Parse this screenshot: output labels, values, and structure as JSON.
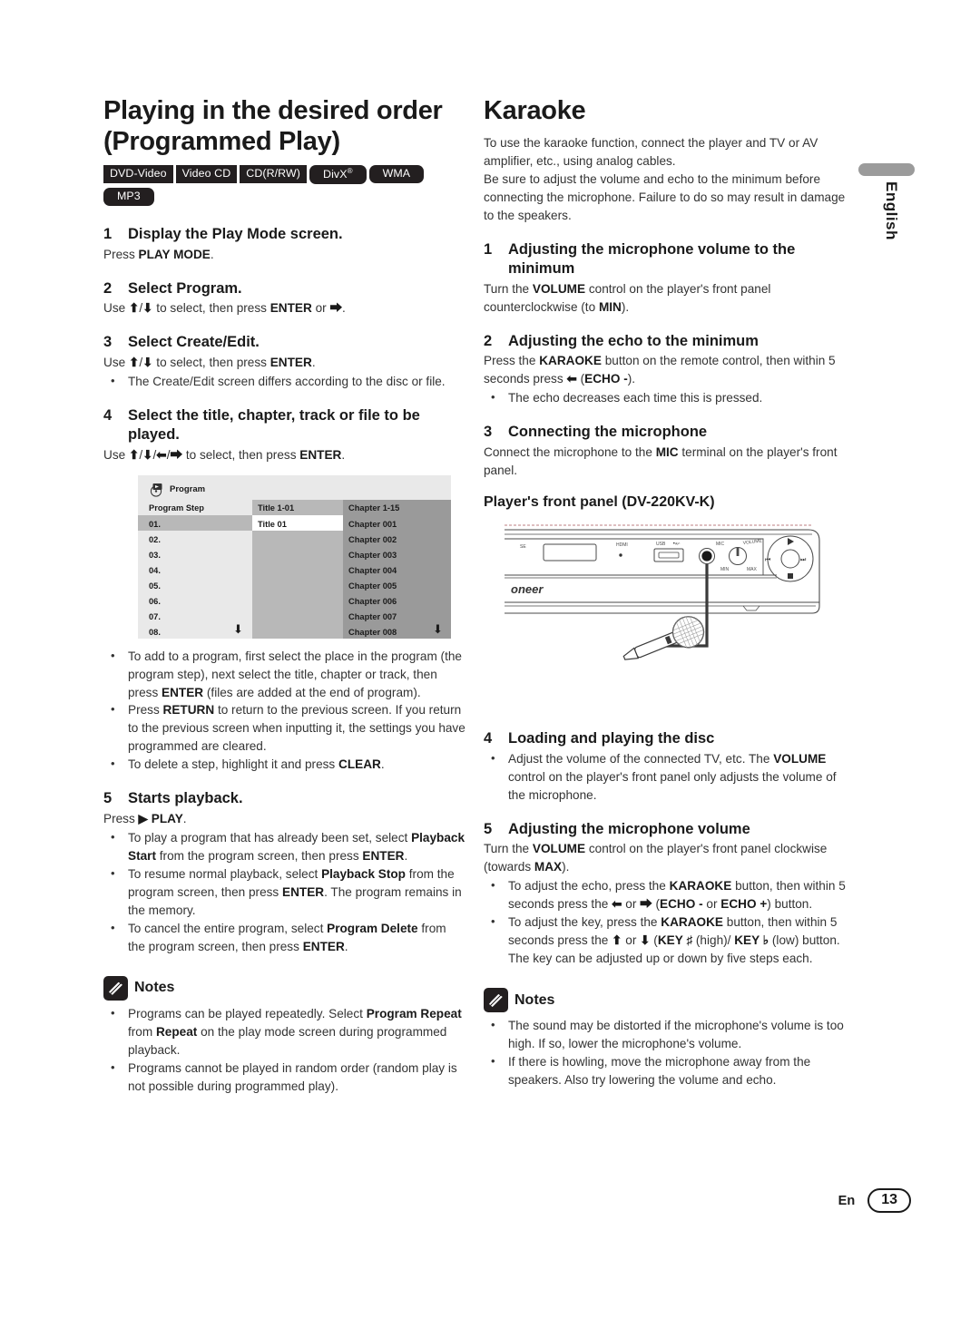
{
  "page": {
    "language_tab": "English",
    "footer_locale": "En",
    "page_number": "13"
  },
  "left_column": {
    "title": "Playing in the desired order (Programmed Play)",
    "badges": [
      {
        "label": "DVD-Video",
        "shape": "square"
      },
      {
        "label": "Video CD",
        "shape": "square"
      },
      {
        "label": "CD(R/RW)",
        "shape": "square"
      },
      {
        "label": "DivX®",
        "shape": "round"
      },
      {
        "label": "WMA",
        "shape": "round"
      },
      {
        "label": "MP3",
        "shape": "round"
      }
    ],
    "steps": [
      {
        "num": "1",
        "head": "Display the Play Mode screen.",
        "body_html": "Press <b>PLAY MODE</b>.",
        "bullets": []
      },
      {
        "num": "2",
        "head": "Select Program.",
        "body_html": "Use <b>⬆</b>/<b>⬇</b> to select, then press <b>ENTER</b> or <b>⮕</b>.",
        "bullets": []
      },
      {
        "num": "3",
        "head": "Select Create/Edit.",
        "body_html": "Use <b>⬆</b>/<b>⬇</b> to select, then press <b>ENTER</b>.",
        "bullets": [
          "The Create/Edit screen differs according to the disc or file."
        ]
      },
      {
        "num": "4",
        "head": "Select the title, chapter, track or file to be played.",
        "body_html": "Use <b>⬆</b>/<b>⬇</b>/<b>⬅</b>/<b>⮕</b> to select, then press <b>ENTER</b>.",
        "bullets": []
      }
    ],
    "osd": {
      "title": "Program",
      "header_step": "Program Step",
      "header_title": "Title  1-01",
      "header_chapter": "Chapter  1-15",
      "steps": [
        "01.",
        "02.",
        "03.",
        "04.",
        "05.",
        "06.",
        "07.",
        "08."
      ],
      "selected_title_cell": "Title  01",
      "chapters": [
        "Chapter  001",
        "Chapter  002",
        "Chapter  003",
        "Chapter  004",
        "Chapter  005",
        "Chapter  006",
        "Chapter  007",
        "Chapter  008"
      ],
      "scroll_arrow": "⬇"
    },
    "after_osd_bullets": [
      "To add to a program, first select the place in the program (the program step), next select the title, chapter or track, then press <b>ENTER</b> (files are added at the end of program).",
      "Press <b>RETURN</b> to return to the previous screen. If you return to the previous screen when inputting it, the settings you have programmed are cleared.",
      "To delete a step, highlight it and press <b>CLEAR</b>."
    ],
    "step5": {
      "num": "5",
      "head": "Starts playback.",
      "body_html": "Press <b>▶ PLAY</b>.",
      "bullets": [
        "To play a program that has already been set, select <b>Playback Start</b> from the program screen, then press <b>ENTER</b>.",
        "To resume normal playback, select <b>Playback Stop</b> from the program screen, then press <b>ENTER</b>. The program remains in the memory.",
        "To cancel the entire program, select <b>Program Delete</b> from the program screen, then press <b>ENTER</b>."
      ]
    },
    "notes": {
      "label": "Notes",
      "items": [
        "Programs can be played repeatedly. Select <b>Program Repeat</b> from <b>Repeat</b> on the play mode screen during programmed playback.",
        "Programs cannot be played in random order (random play is not possible during programmed play)."
      ]
    }
  },
  "right_column": {
    "title": "Karaoke",
    "intro": [
      "To use the karaoke function, connect the player and TV or AV amplifier, etc., using analog cables.",
      "Be sure to adjust the volume and echo to the minimum before connecting the microphone. Failure to do so may result in damage to the speakers."
    ],
    "steps": [
      {
        "num": "1",
        "head": "Adjusting the microphone volume to the minimum",
        "body_html": "Turn the <b>VOLUME</b> control on the player's front panel counterclockwise (to <b>MIN</b>).",
        "bullets": []
      },
      {
        "num": "2",
        "head": "Adjusting the echo to the minimum",
        "body_html": "Press the <b>KARAOKE</b> button on the remote control, then within 5 seconds press <b>⬅</b> (<b>ECHO -</b>).",
        "bullets": [
          "The echo decreases each time this is pressed."
        ]
      },
      {
        "num": "3",
        "head": "Connecting the microphone",
        "body_html": "Connect the microphone to the <b>MIC</b> terminal on the player's front panel.",
        "bullets": []
      }
    ],
    "panel": {
      "caption": "Player's front panel (DV-220KV-K)",
      "labels": {
        "hdmi": "HDMI",
        "usb": "USB",
        "mic": "MIC",
        "volume": "VOLUME",
        "min": "MIN",
        "max": "MAX",
        "brand": "oneer"
      }
    },
    "steps_after_panel": [
      {
        "num": "4",
        "head": "Loading and playing the disc",
        "body_html": "",
        "bullets": [
          "Adjust the volume of the connected TV, etc. The <b>VOLUME</b> control on the player's front panel only adjusts the volume of the microphone."
        ]
      },
      {
        "num": "5",
        "head": "Adjusting the microphone volume",
        "body_html": "Turn the <b>VOLUME</b> control on the player's front panel clockwise (towards <b>MAX</b>).",
        "bullets": [
          "To adjust the echo, press the <b>KARAOKE</b> button, then within 5 seconds press the <b>⬅</b> or <b>⮕</b> (<b>ECHO -</b> or <b>ECHO +</b>) button.",
          "To adjust the key, press the <b>KARAOKE</b> button, then within 5 seconds press the <b>⬆</b> or <b>⬇</b> (<b>KEY ♯</b> (high)/ <b>KEY ♭</b> (low) button. The key can be adjusted up or down by five steps each."
        ]
      }
    ],
    "notes": {
      "label": "Notes",
      "items": [
        "The sound may be distorted if the microphone's volume is too high. If so, lower the microphone's volume.",
        "If there is howling, move the microphone away from the speakers. Also try lowering the volume and echo."
      ]
    }
  }
}
